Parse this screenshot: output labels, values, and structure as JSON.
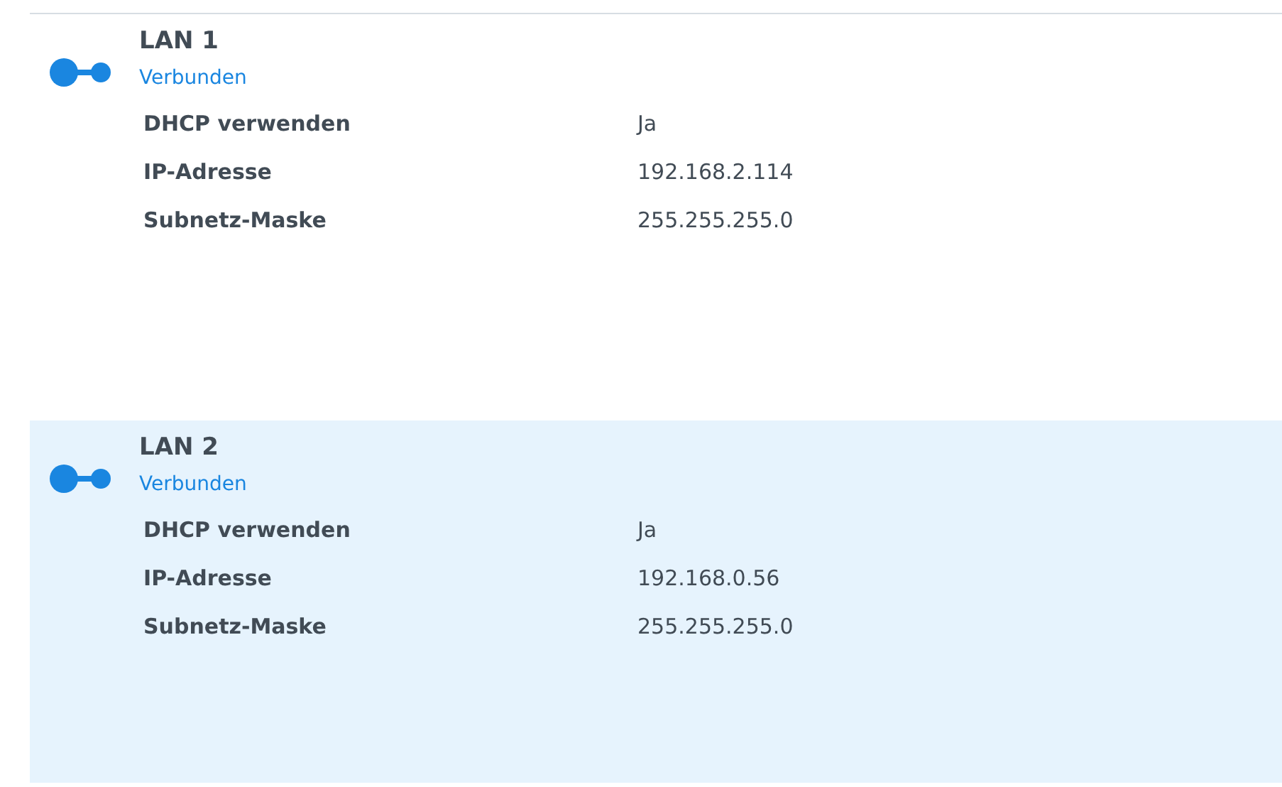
{
  "interfaces": [
    {
      "name": "LAN 1",
      "status": "Verbunden",
      "selected": false,
      "details": [
        {
          "label": "DHCP verwenden",
          "value": "Ja"
        },
        {
          "label": "IP-Adresse",
          "value": "192.168.2.114"
        },
        {
          "label": "Subnetz-Maske",
          "value": "255.255.255.0"
        }
      ]
    },
    {
      "name": "LAN 2",
      "status": "Verbunden",
      "selected": true,
      "details": [
        {
          "label": "DHCP verwenden",
          "value": "Ja"
        },
        {
          "label": "IP-Adresse",
          "value": "192.168.0.56"
        },
        {
          "label": "Subnetz-Maske",
          "value": "255.255.255.0"
        }
      ]
    }
  ]
}
